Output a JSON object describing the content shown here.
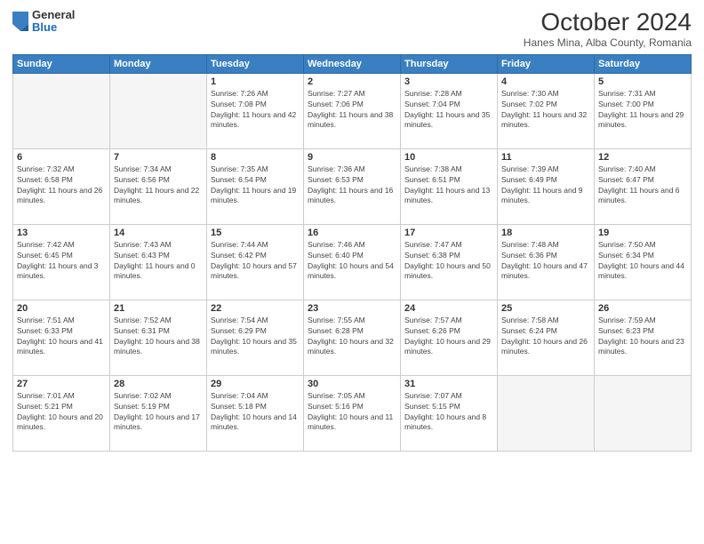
{
  "logo": {
    "general": "General",
    "blue": "Blue"
  },
  "title": "October 2024",
  "subtitle": "Hanes Mina, Alba County, Romania",
  "days_header": [
    "Sunday",
    "Monday",
    "Tuesday",
    "Wednesday",
    "Thursday",
    "Friday",
    "Saturday"
  ],
  "weeks": [
    [
      {
        "day": "",
        "info": ""
      },
      {
        "day": "",
        "info": ""
      },
      {
        "day": "1",
        "info": "Sunrise: 7:26 AM\nSunset: 7:08 PM\nDaylight: 11 hours and 42 minutes."
      },
      {
        "day": "2",
        "info": "Sunrise: 7:27 AM\nSunset: 7:06 PM\nDaylight: 11 hours and 38 minutes."
      },
      {
        "day": "3",
        "info": "Sunrise: 7:28 AM\nSunset: 7:04 PM\nDaylight: 11 hours and 35 minutes."
      },
      {
        "day": "4",
        "info": "Sunrise: 7:30 AM\nSunset: 7:02 PM\nDaylight: 11 hours and 32 minutes."
      },
      {
        "day": "5",
        "info": "Sunrise: 7:31 AM\nSunset: 7:00 PM\nDaylight: 11 hours and 29 minutes."
      }
    ],
    [
      {
        "day": "6",
        "info": "Sunrise: 7:32 AM\nSunset: 6:58 PM\nDaylight: 11 hours and 26 minutes."
      },
      {
        "day": "7",
        "info": "Sunrise: 7:34 AM\nSunset: 6:56 PM\nDaylight: 11 hours and 22 minutes."
      },
      {
        "day": "8",
        "info": "Sunrise: 7:35 AM\nSunset: 6:54 PM\nDaylight: 11 hours and 19 minutes."
      },
      {
        "day": "9",
        "info": "Sunrise: 7:36 AM\nSunset: 6:53 PM\nDaylight: 11 hours and 16 minutes."
      },
      {
        "day": "10",
        "info": "Sunrise: 7:38 AM\nSunset: 6:51 PM\nDaylight: 11 hours and 13 minutes."
      },
      {
        "day": "11",
        "info": "Sunrise: 7:39 AM\nSunset: 6:49 PM\nDaylight: 11 hours and 9 minutes."
      },
      {
        "day": "12",
        "info": "Sunrise: 7:40 AM\nSunset: 6:47 PM\nDaylight: 11 hours and 6 minutes."
      }
    ],
    [
      {
        "day": "13",
        "info": "Sunrise: 7:42 AM\nSunset: 6:45 PM\nDaylight: 11 hours and 3 minutes."
      },
      {
        "day": "14",
        "info": "Sunrise: 7:43 AM\nSunset: 6:43 PM\nDaylight: 11 hours and 0 minutes."
      },
      {
        "day": "15",
        "info": "Sunrise: 7:44 AM\nSunset: 6:42 PM\nDaylight: 10 hours and 57 minutes."
      },
      {
        "day": "16",
        "info": "Sunrise: 7:46 AM\nSunset: 6:40 PM\nDaylight: 10 hours and 54 minutes."
      },
      {
        "day": "17",
        "info": "Sunrise: 7:47 AM\nSunset: 6:38 PM\nDaylight: 10 hours and 50 minutes."
      },
      {
        "day": "18",
        "info": "Sunrise: 7:48 AM\nSunset: 6:36 PM\nDaylight: 10 hours and 47 minutes."
      },
      {
        "day": "19",
        "info": "Sunrise: 7:50 AM\nSunset: 6:34 PM\nDaylight: 10 hours and 44 minutes."
      }
    ],
    [
      {
        "day": "20",
        "info": "Sunrise: 7:51 AM\nSunset: 6:33 PM\nDaylight: 10 hours and 41 minutes."
      },
      {
        "day": "21",
        "info": "Sunrise: 7:52 AM\nSunset: 6:31 PM\nDaylight: 10 hours and 38 minutes."
      },
      {
        "day": "22",
        "info": "Sunrise: 7:54 AM\nSunset: 6:29 PM\nDaylight: 10 hours and 35 minutes."
      },
      {
        "day": "23",
        "info": "Sunrise: 7:55 AM\nSunset: 6:28 PM\nDaylight: 10 hours and 32 minutes."
      },
      {
        "day": "24",
        "info": "Sunrise: 7:57 AM\nSunset: 6:26 PM\nDaylight: 10 hours and 29 minutes."
      },
      {
        "day": "25",
        "info": "Sunrise: 7:58 AM\nSunset: 6:24 PM\nDaylight: 10 hours and 26 minutes."
      },
      {
        "day": "26",
        "info": "Sunrise: 7:59 AM\nSunset: 6:23 PM\nDaylight: 10 hours and 23 minutes."
      }
    ],
    [
      {
        "day": "27",
        "info": "Sunrise: 7:01 AM\nSunset: 5:21 PM\nDaylight: 10 hours and 20 minutes."
      },
      {
        "day": "28",
        "info": "Sunrise: 7:02 AM\nSunset: 5:19 PM\nDaylight: 10 hours and 17 minutes."
      },
      {
        "day": "29",
        "info": "Sunrise: 7:04 AM\nSunset: 5:18 PM\nDaylight: 10 hours and 14 minutes."
      },
      {
        "day": "30",
        "info": "Sunrise: 7:05 AM\nSunset: 5:16 PM\nDaylight: 10 hours and 11 minutes."
      },
      {
        "day": "31",
        "info": "Sunrise: 7:07 AM\nSunset: 5:15 PM\nDaylight: 10 hours and 8 minutes."
      },
      {
        "day": "",
        "info": ""
      },
      {
        "day": "",
        "info": ""
      }
    ]
  ]
}
